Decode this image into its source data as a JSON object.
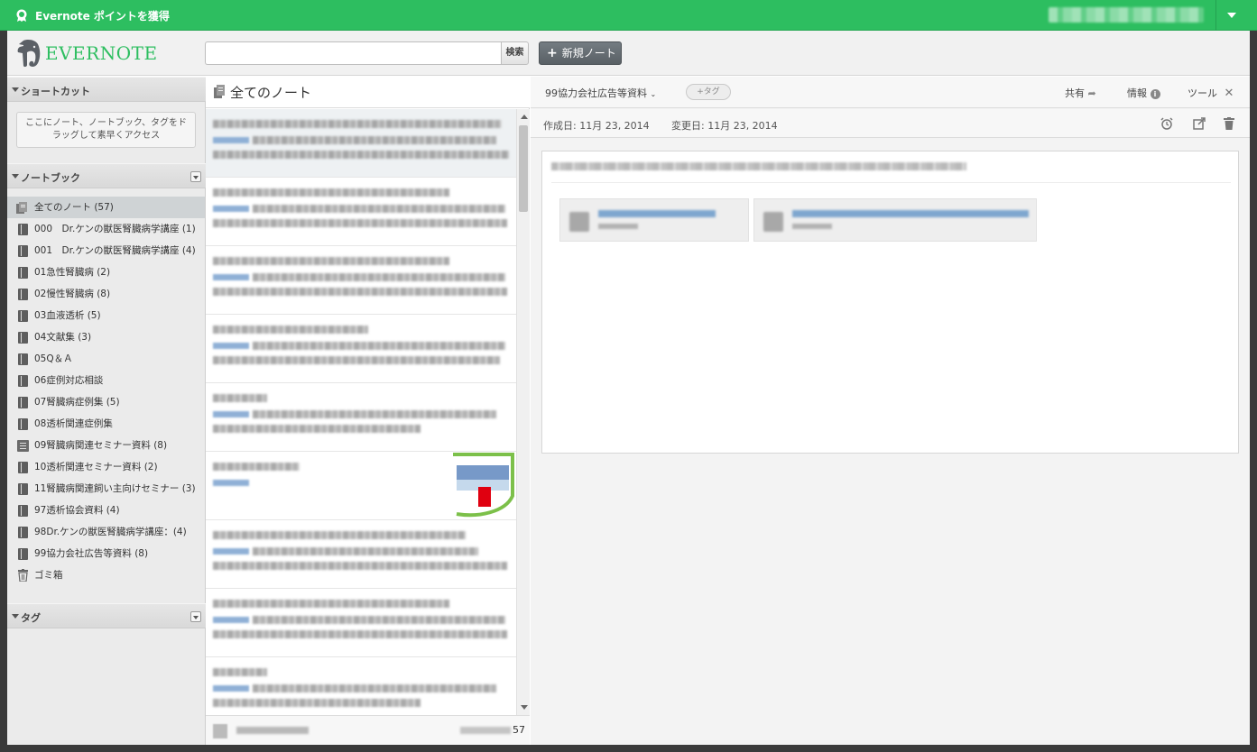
{
  "topbar": {
    "points_label": "Evernote ポイントを獲得"
  },
  "header": {
    "logo_text": "EVERNOTE",
    "search": {
      "placeholder": "",
      "button_label": "検索"
    },
    "new_note_label": "新規ノート"
  },
  "sidebar": {
    "shortcuts_title": "ショートカット",
    "shortcuts_hint": "ここにノート、ノートブック、タグをドラッグして素早くアクセス",
    "notebooks_title": "ノートブック",
    "tags_title": "タグ",
    "items": [
      {
        "label": "全てのノート (57)",
        "icon": "all-notes-icon",
        "selected": true
      },
      {
        "label": "000　Dr.ケンの獣医腎臓病学講座 (1)",
        "icon": "notebook-icon"
      },
      {
        "label": "001　Dr.ケンの獣医腎臓病学講座 (4)",
        "icon": "notebook-icon"
      },
      {
        "label": "01急性腎臓病 (2)",
        "icon": "notebook-icon"
      },
      {
        "label": "02慢性腎臓病 (8)",
        "icon": "notebook-icon"
      },
      {
        "label": "03血液透析 (5)",
        "icon": "notebook-icon"
      },
      {
        "label": "04文献集 (3)",
        "icon": "notebook-icon"
      },
      {
        "label": "05Q＆Ａ",
        "icon": "notebook-icon"
      },
      {
        "label": "06症例対応相談",
        "icon": "notebook-icon"
      },
      {
        "label": "07腎臓病症例集 (5)",
        "icon": "notebook-icon"
      },
      {
        "label": "08透析関連症例集",
        "icon": "notebook-icon"
      },
      {
        "label": "09腎臓病関連セミナー資料 (8)",
        "icon": "shared-notebook-icon"
      },
      {
        "label": "10透析関連セミナー資料 (2)",
        "icon": "notebook-icon"
      },
      {
        "label": "11腎臓病関連飼い主向けセミナー (3)",
        "icon": "notebook-icon"
      },
      {
        "label": "97透析協会資料 (4)",
        "icon": "notebook-icon"
      },
      {
        "label": "98Dr.ケンの獣医腎臓病学講座：(4)",
        "icon": "notebook-icon"
      },
      {
        "label": "99協力会社広告等資料 (8)",
        "icon": "notebook-icon"
      },
      {
        "label": "ゴミ箱",
        "icon": "trash-icon"
      }
    ]
  },
  "notelist": {
    "title": "全てのノート",
    "count": "57"
  },
  "viewer": {
    "notebook": "99協力会社広告等資料",
    "tag_button": "+タグ",
    "share_label": "共有",
    "info_label": "情報",
    "tools_label": "ツール",
    "created": "作成日: 11月 23, 2014",
    "modified": "変更日: 11月 23, 2014"
  },
  "colors": {
    "brand_green": "#2dbe60",
    "button_gray": "#5f666b",
    "selection": "#cfd3d5"
  }
}
